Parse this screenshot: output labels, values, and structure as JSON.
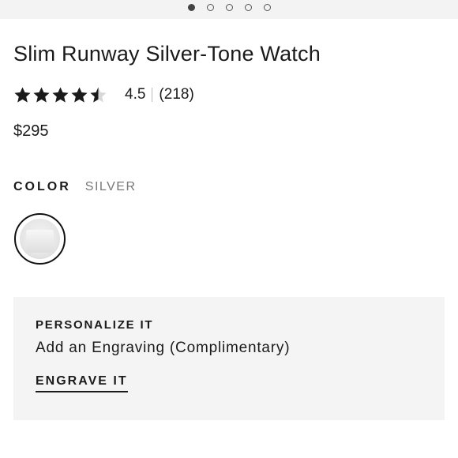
{
  "carousel": {
    "total": 5,
    "active_index": 0
  },
  "product": {
    "title": "Slim Runway Silver-Tone Watch",
    "price": "$295"
  },
  "rating": {
    "value": "4.5",
    "count": "(218)",
    "stars_filled": 4.5,
    "stars_max": 5
  },
  "color": {
    "label": "COLOR",
    "selected": "SILVER",
    "swatch_name": "silver-swatch"
  },
  "personalize": {
    "title": "PERSONALIZE IT",
    "subtitle": "Add an Engraving (Complimentary)",
    "link": "ENGRAVE IT"
  },
  "colors": {
    "text": "#1a1a1a",
    "muted": "#777777",
    "panel": "#f4f4f4",
    "strip": "#f3f3f3"
  }
}
